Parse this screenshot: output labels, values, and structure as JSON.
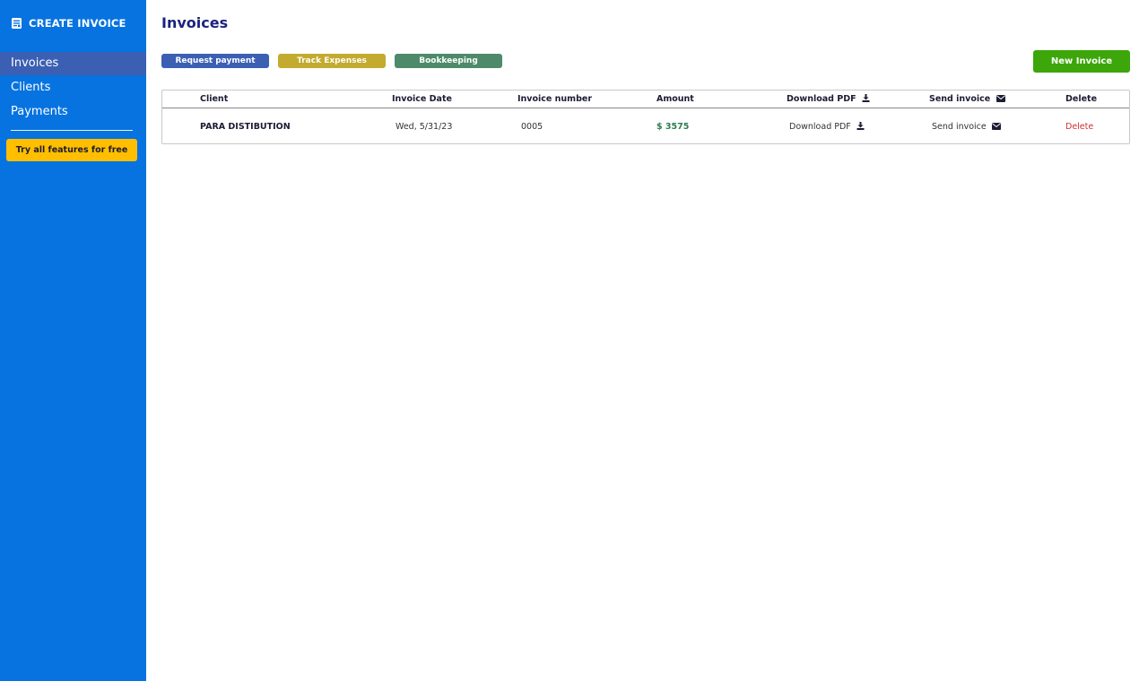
{
  "sidebar": {
    "brand": "CREATE INVOICE",
    "brand_icon": "invoice-icon",
    "items": [
      {
        "label": "Invoices",
        "active": true
      },
      {
        "label": "Clients",
        "active": false
      },
      {
        "label": "Payments",
        "active": false
      }
    ],
    "cta": "Try all features for free",
    "colors": {
      "background": "#0773e0",
      "active": "#3b5fb3",
      "cta": "#ffbf00"
    }
  },
  "main": {
    "title": "Invoices",
    "actions": [
      {
        "label": "Request payment",
        "color": "#3b5fb3"
      },
      {
        "label": "Track Expenses",
        "color": "#c2ab2e"
      },
      {
        "label": "Bookkeeping",
        "color": "#4e8a6a"
      }
    ],
    "new_button": "New Invoice",
    "new_button_color": "#3ca60a"
  },
  "table": {
    "headers": {
      "client": "Client",
      "date": "Invoice Date",
      "number": "Invoice number",
      "amount": "Amount",
      "pdf": "Download PDF",
      "send": "Send invoice",
      "delete": "Delete"
    },
    "header_icons": {
      "pdf": "download-icon",
      "send": "envelope-icon"
    },
    "rows": [
      {
        "client": "PARA DISTIBUTION",
        "date": "Wed, 5/31/23",
        "number": "0005",
        "amount": "$ 3575",
        "pdf": "Download PDF",
        "send": "Send invoice",
        "delete": "Delete"
      }
    ]
  }
}
